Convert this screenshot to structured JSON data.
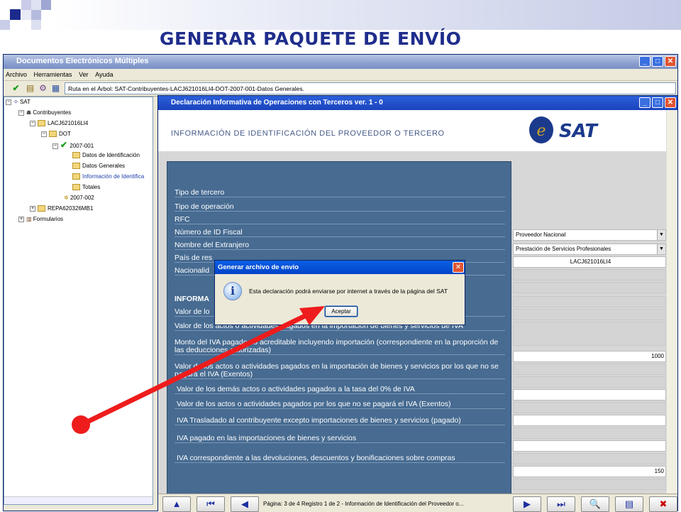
{
  "slide": {
    "title": "GENERAR PAQUETE DE ENVÍO"
  },
  "app": {
    "title": "Documentos Electrónicos Múltiples",
    "window_buttons": [
      "_",
      "□",
      "✕"
    ],
    "menu": [
      "Archivo",
      "Herramientas",
      "Ver",
      "Ayuda"
    ],
    "path": "Ruta en el Árbol: SAT-Contribuyentes-LACJ621016LI4-DOT-2007-001-Datos Generales."
  },
  "tree": {
    "sat": "SAT",
    "contribuyentes": "Contribuyentes",
    "rfc1": "LACJ621016LI4",
    "dot": "DOT",
    "y2007_001": "2007-001",
    "datos_identificacion": "Datos de Identificación",
    "datos_generales": "Datos Generales",
    "informacion": "Información de Identifica",
    "totales": "Totales",
    "y2007_002": "2007-002",
    "rfc2": "REPA620326MB1",
    "formularios": "Formularios"
  },
  "child": {
    "title": "Declaración Informativa de Operaciones con Terceros ver. 1 - 0",
    "heading": "INFORMACIÓN DE IDENTIFICACIÓN DEL PROVEEDOR O TERCERO",
    "logo": "SAT"
  },
  "form": {
    "tipo_tercero": {
      "label": "Tipo de tercero",
      "value": "Proveedor Nacional"
    },
    "tipo_operacion": {
      "label": "Tipo de operación",
      "value": "Prestación de Servicios Profesionales"
    },
    "rfc": {
      "label": "RFC",
      "value": "LACJ621016LI4"
    },
    "id_fiscal": {
      "label": "Número de ID Fiscal"
    },
    "nombre_extranjero": {
      "label": "Nombre del Extranjero"
    },
    "pais": {
      "label": "País de res"
    },
    "nacionalidad": {
      "label": "Nacionalid"
    },
    "section": "INFORMA",
    "valor_actos": {
      "label": "Valor de lo",
      "value": "1000"
    },
    "rows": [
      "Valor de los actos o actividades pagados en la importación de bienes y servicios de IVA",
      "Monto del IVA pagado no acreditable incluyendo importación (correspondiente en la proporción de las deducciones autorizadas)",
      "Valor de los actos o actividades pagados en la importación de bienes y servicios por los que no se pagará el IVA (Exentos)",
      "Valor de los demás actos o actividades pagados a la tasa del 0% de IVA",
      "Valor de los actos o actividades pagados por los que no se pagará el IVA (Exentos)",
      "IVA Trasladado al contribuyente excepto importaciones de bienes y servicios (pagado)",
      "IVA pagado en las importaciones de bienes y servicios",
      "IVA correspondiente a las devoluciones, descuentos y bonificaciones sobre compras"
    ],
    "iva_trasladado_value": "150"
  },
  "nav": {
    "status": "Página: 3  de  4 Registro  1  de  2 -  Información de Identificación del Proveedor o..."
  },
  "dialog": {
    "title": "Generar archivo de envio",
    "message": "Esta declaración podrá enviarse por internet a través de la página del SAT",
    "button": "Aceptar",
    "close": "✕"
  },
  "colors": {
    "title": "#1f2d8c",
    "panel": "#476b91",
    "arrow": "#ee1c1c",
    "titlebar": "#1b44bd"
  }
}
